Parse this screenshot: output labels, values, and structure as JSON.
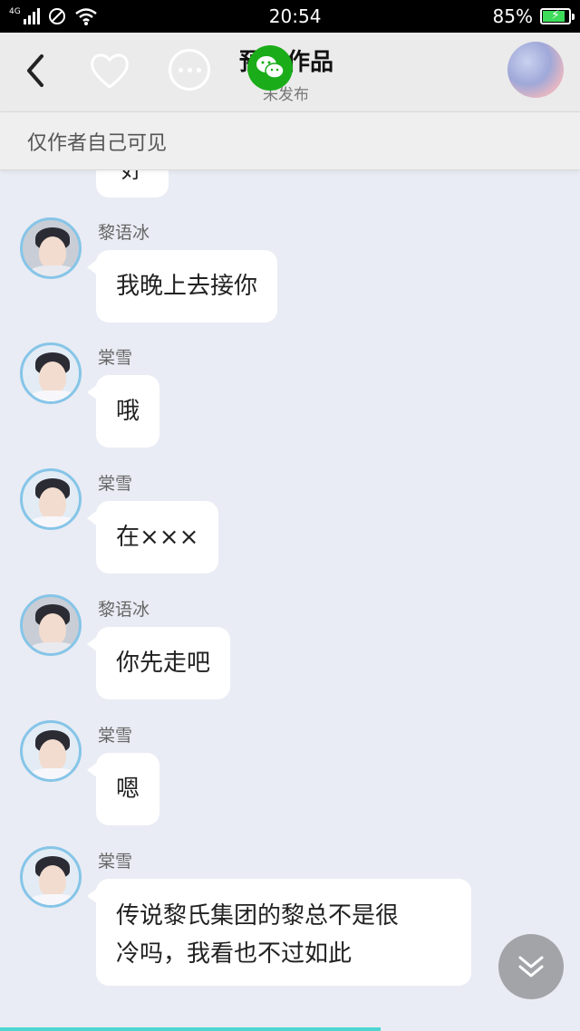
{
  "status_bar": {
    "network": "4G",
    "time": "20:54",
    "battery": "85%",
    "battery_level": 0.85
  },
  "header": {
    "title": "預先作品",
    "subtitle": "未发布"
  },
  "notice": {
    "text": "仅作者自己可见"
  },
  "chat": {
    "partial_top_text": "好",
    "messages": [
      {
        "sender": "黎语冰",
        "text": "我晚上去接你",
        "avatar": "male-avatar"
      },
      {
        "sender": "棠雪",
        "text": "哦",
        "avatar": "female-avatar"
      },
      {
        "sender": "棠雪",
        "text": "在×××",
        "avatar": "female-avatar"
      },
      {
        "sender": "黎语冰",
        "text": "你先走吧",
        "avatar": "male-avatar"
      },
      {
        "sender": "棠雪",
        "text": "嗯",
        "avatar": "female-avatar"
      },
      {
        "sender": "棠雪",
        "text_line1": "传说黎氏集团的黎总不是很",
        "text_line2": "冷吗，我看也不过如此",
        "avatar": "female-avatar"
      }
    ]
  },
  "colors": {
    "background": "#e9ecf4",
    "accent_wechat": "#1aad19",
    "avatar_border": "#86c5e8",
    "progress_line": "#4fd6d2"
  }
}
